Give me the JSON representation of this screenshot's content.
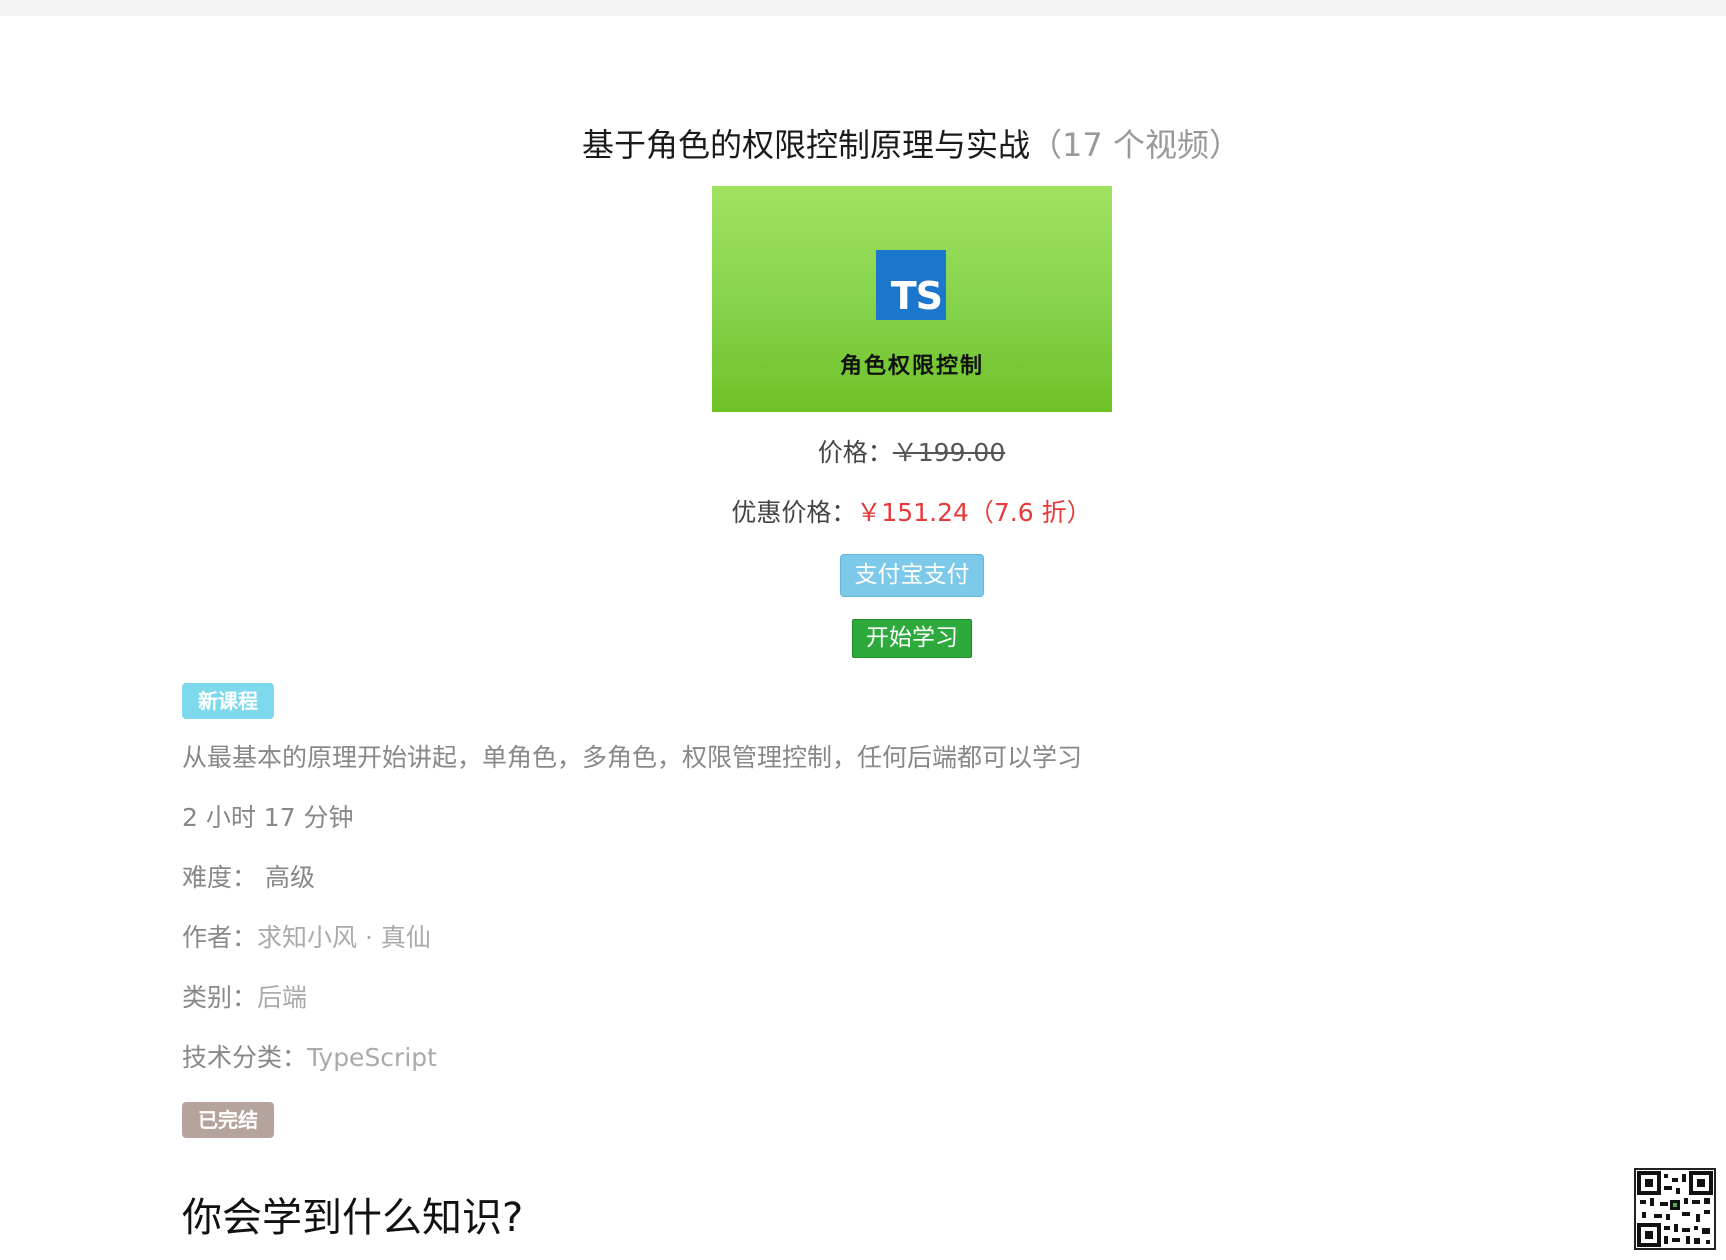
{
  "course": {
    "title": "基于角色的权限控制原理与实战",
    "video_count": "（17 个视频）",
    "cover_logo": "TS",
    "cover_caption": "角色权限控制",
    "price_label": "价格：",
    "price_original": "￥199.00",
    "discount_label": "优惠价格：",
    "discount_price": "￥151.24（7.6 折）",
    "alipay_button": "支付宝支付",
    "start_button": "开始学习",
    "badge_new": "新课程",
    "description": "从最基本的原理开始讲起，单角色，多角色，权限管理控制，任何后端都可以学习",
    "duration": "2 小时 17 分钟",
    "level_label": "难度：",
    "level_value": "高级",
    "author_label": "作者：",
    "author_value": "求知小风 · 真仙",
    "category_label": "类别：",
    "category_value": "后端",
    "tech_label": "技术分类：",
    "tech_value": "TypeScript",
    "badge_done": "已完结",
    "section_heading": "你会学到什么知识?"
  },
  "colors": {
    "discount_red": "#e63a3a",
    "alipay_blue": "#7dc9ea",
    "study_green": "#2eaa3c",
    "badge_new": "#7fd9ec",
    "badge_done": "#b5a49c",
    "ts_blue": "#1b77cc"
  },
  "icons": {
    "qr": "qr-code-icon",
    "ts_logo": "typescript-logo-icon"
  }
}
